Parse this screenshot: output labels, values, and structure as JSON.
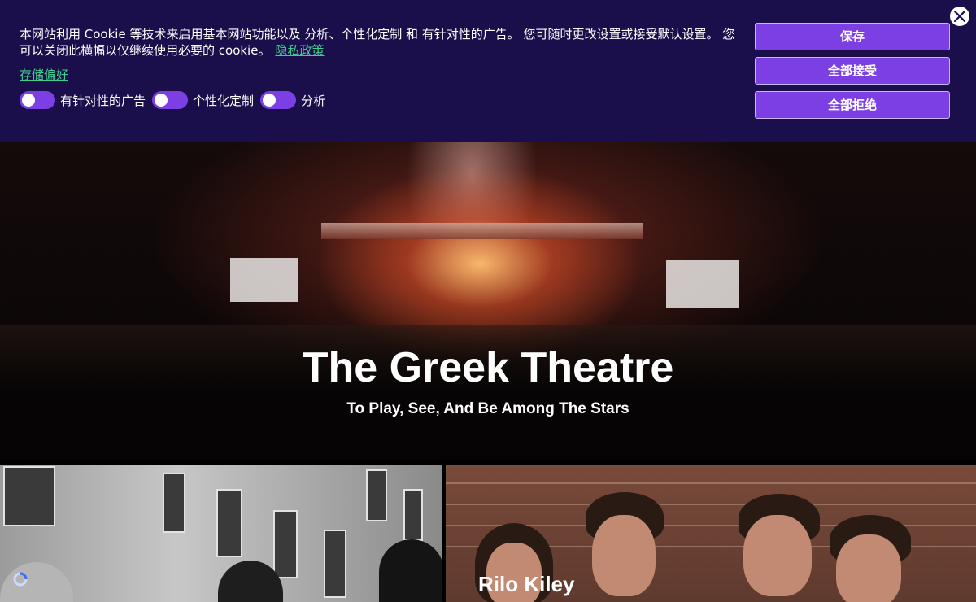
{
  "cookie_banner": {
    "message": "本网站利用 Cookie 等技术来启用基本网站功能以及 分析、个性化定制 和 有针对性的广告。 您可随时更改设置或接受默认设置。 您可以关闭此横幅以仅继续使用必要的 cookie。",
    "privacy_link": "隐私政策",
    "store_preferences": "存储偏好",
    "toggles": [
      {
        "label": "有针对性的广告"
      },
      {
        "label": "个性化定制"
      },
      {
        "label": "分析"
      }
    ],
    "buttons": {
      "save": "保存",
      "accept_all": "全部接受",
      "reject_all": "全部拒绝"
    },
    "close_icon": "close-icon",
    "colors": {
      "background": "#1b0f4b",
      "accent": "#7b3fe4",
      "link": "#3ecf8e"
    }
  },
  "hero": {
    "title": "The Greek Theatre",
    "subtitle": "To Play, See, And Be Among The Stars"
  },
  "cards": [
    {
      "title": ""
    },
    {
      "title": "Rilo Kiley"
    }
  ]
}
